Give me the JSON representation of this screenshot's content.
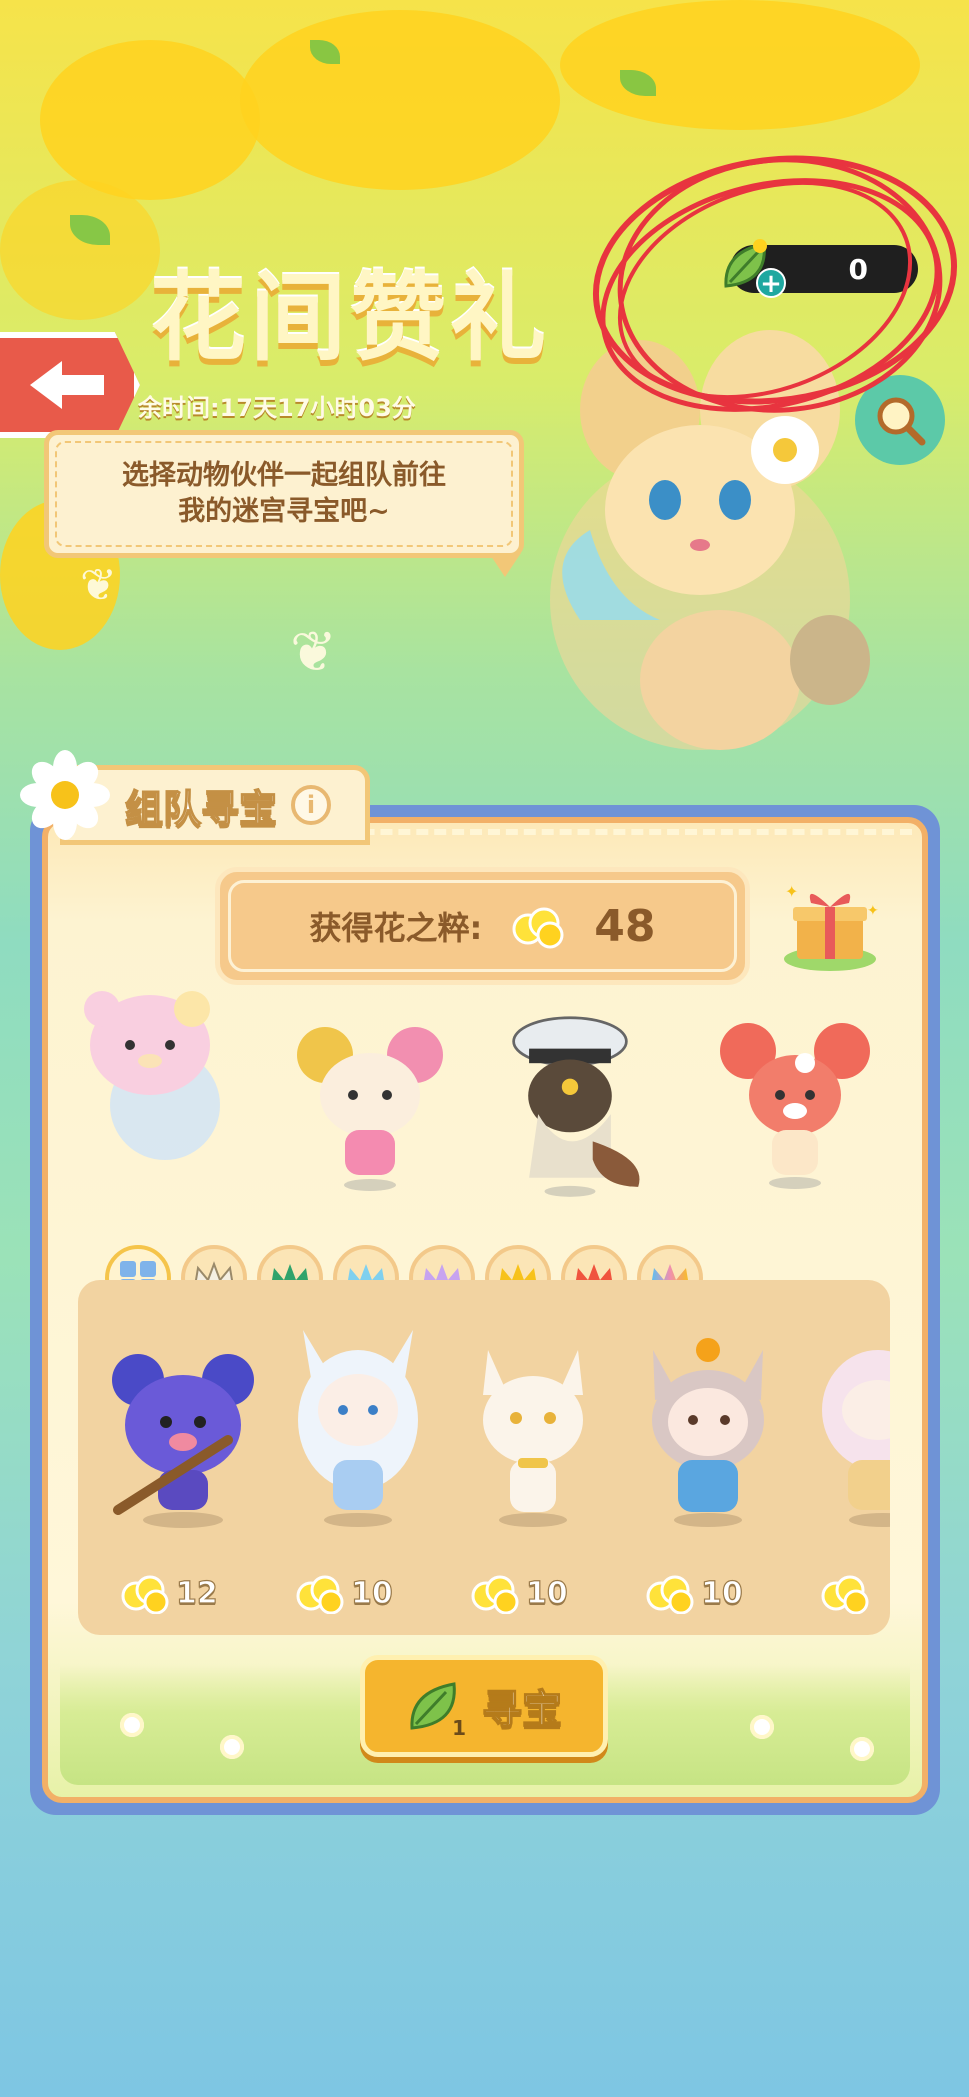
{
  "header": {
    "title": "花间赞礼",
    "timer": "余时间:17天17小时03分",
    "speech": "选择动物伙伴一起组队前往\n我的迷宫寻宝吧~"
  },
  "currency": {
    "value": "0",
    "icon": "leaf-icon"
  },
  "panel": {
    "tab_label": "组队寻宝",
    "reward_label": "获得花之粹:",
    "reward_value": "48"
  },
  "filters": [
    {
      "name": "all",
      "icon": "grid-icon"
    },
    {
      "name": "white",
      "color": "#f4efe2"
    },
    {
      "name": "green",
      "color": "#2fa36b"
    },
    {
      "name": "blue",
      "color": "#7fd0ef"
    },
    {
      "name": "purple",
      "color": "#c7a3f0"
    },
    {
      "name": "yellow",
      "color": "#f7c21a"
    },
    {
      "name": "red",
      "color": "#f0543e"
    },
    {
      "name": "rainbow",
      "color": "#f08fb0"
    }
  ],
  "pets": [
    {
      "cost": "12",
      "theme": "blueberry-bear"
    },
    {
      "cost": "10",
      "theme": "white-fox-girl"
    },
    {
      "cost": "10",
      "theme": "white-cat"
    },
    {
      "cost": "10",
      "theme": "bell-girl"
    },
    {
      "cost": "",
      "theme": "pink-fox"
    }
  ],
  "hunt_button": {
    "label": "寻宝",
    "cost": "1"
  },
  "colors": {
    "accent": "#f5b52e",
    "panel_border": "#6f93d6",
    "annotation": "#e8343f"
  }
}
